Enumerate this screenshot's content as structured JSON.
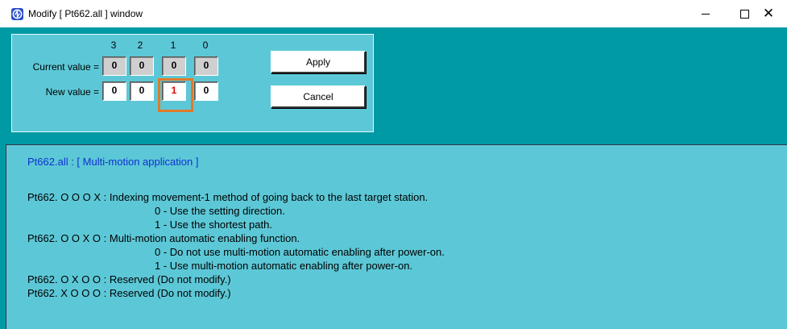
{
  "window": {
    "title": "Modify [ Pt662.all ] window",
    "icon": "app-logo-icon",
    "controls": {
      "minimize": "minimize-icon",
      "maximize": "maximize-icon",
      "close": "close-icon"
    }
  },
  "editor": {
    "digit_headers": [
      "3",
      "2",
      "1",
      "0"
    ],
    "current_label": "Current value =",
    "new_label": "New value =",
    "current_values": [
      "0",
      "0",
      "0",
      "0"
    ],
    "new_values": [
      "0",
      "0",
      "1",
      "0"
    ],
    "changed_digit_index": 2,
    "apply_label": "Apply",
    "cancel_label": "Cancel"
  },
  "description": {
    "title": "Pt662.all :  [ Multi-motion application ]",
    "lines": [
      "Pt662.  O  O  O  X  : Indexing movement-1 method of going back to the last target station.",
      "0 - Use the setting direction.",
      "1 - Use the shortest path.",
      "Pt662.  O  O  X  O  : Multi-motion automatic enabling function.",
      "0 - Do not use multi-motion automatic enabling after power-on.",
      "1 - Use multi-motion automatic enabling after power-on.",
      "Pt662.  O  X  O  O  : Reserved (Do not modify.)",
      "Pt662.  X  O  O  O  : Reserved (Do not modify.)"
    ]
  },
  "colors": {
    "background": "#009aa5",
    "panel": "#5cc8d7",
    "title_text": "#1030d0",
    "changed_digit": "#e00000",
    "highlight": "#e07a2a"
  }
}
